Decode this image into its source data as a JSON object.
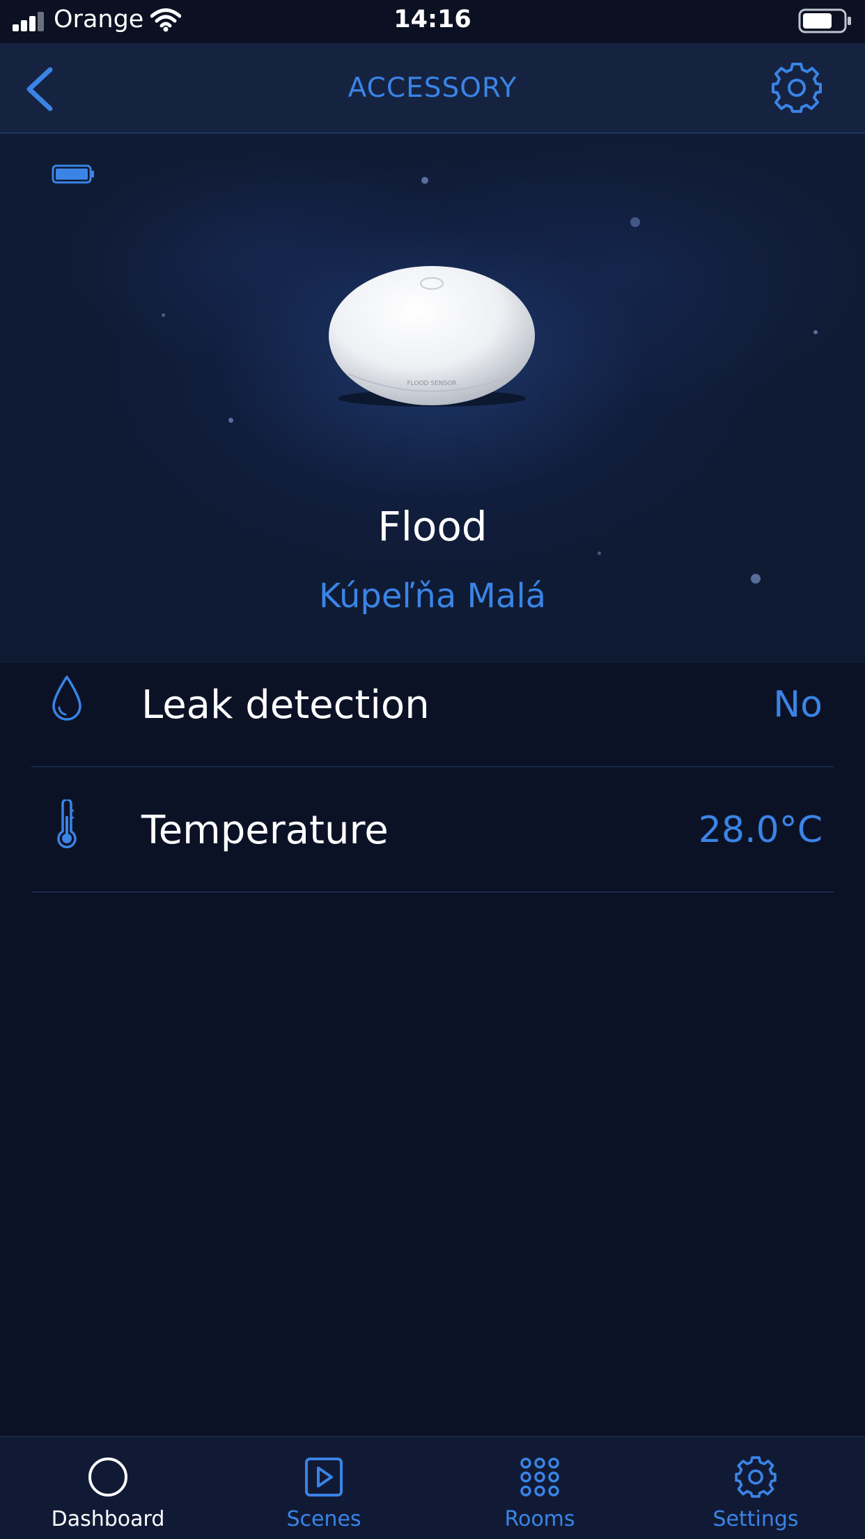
{
  "status_bar": {
    "carrier": "Orange",
    "time": "14:16"
  },
  "nav": {
    "title": "ACCESSORY",
    "back_icon": "chevron-left-icon",
    "settings_icon": "gear-icon"
  },
  "device": {
    "name": "Flood",
    "room": "Kúpeľňa Malá",
    "image_text": "FLOOD SENSOR"
  },
  "rows": [
    {
      "icon": "water-drop-icon",
      "label": "Leak detection",
      "value": "No"
    },
    {
      "icon": "thermometer-icon",
      "label": "Temperature",
      "value": "28.0°C"
    }
  ],
  "tabs": [
    {
      "icon": "circle-icon",
      "label": "Dashboard",
      "active": true
    },
    {
      "icon": "play-square-icon",
      "label": "Scenes",
      "active": false
    },
    {
      "icon": "grid-dots-icon",
      "label": "Rooms",
      "active": false
    },
    {
      "icon": "gear-icon",
      "label": "Settings",
      "active": false
    }
  ],
  "colors": {
    "accent": "#3a84e6",
    "background": "#0c1226",
    "tab_active": "#ffffff",
    "tab_inactive": "#3a84e6"
  }
}
